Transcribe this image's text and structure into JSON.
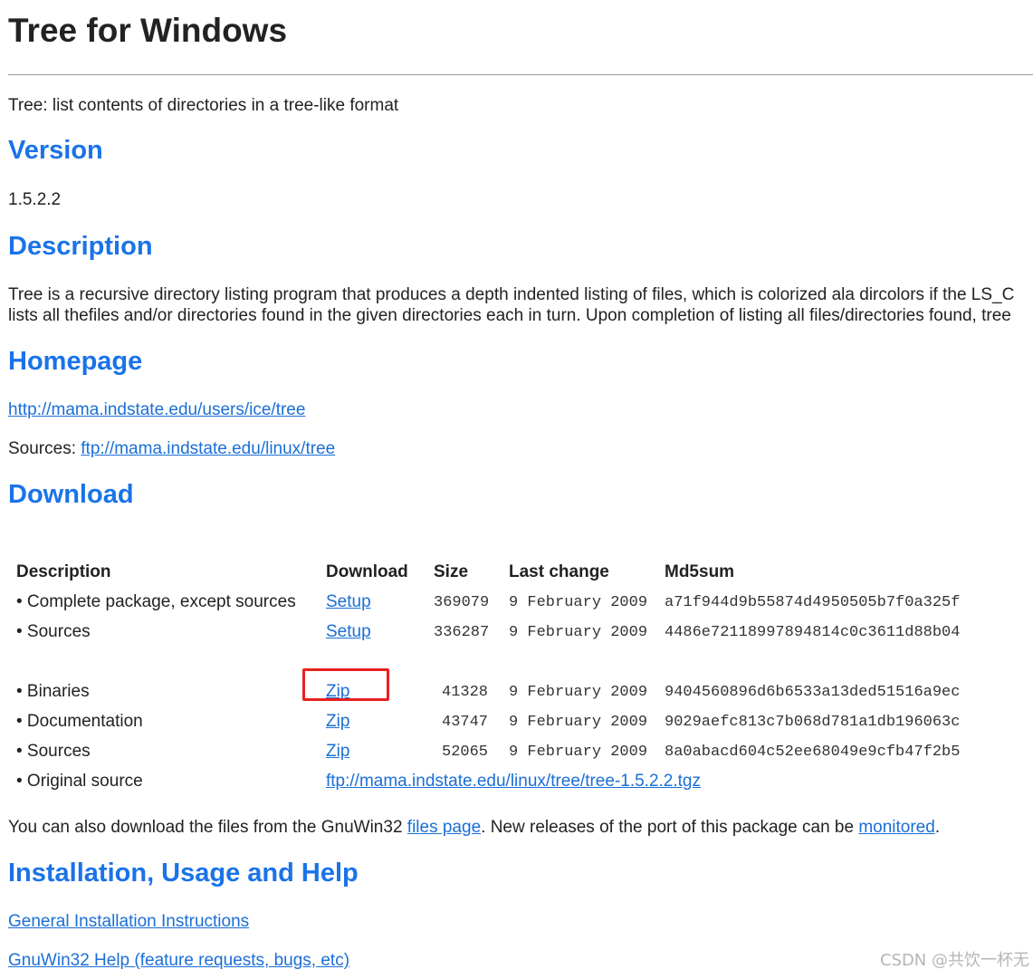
{
  "page": {
    "title": "Tree for Windows",
    "intro": "Tree: list contents of directories in a tree-like format"
  },
  "version": {
    "heading": "Version",
    "value": "1.5.2.2"
  },
  "description": {
    "heading": "Description",
    "line1": "Tree is a recursive directory listing program that produces a depth indented listing of files, which is colorized ala dircolors if the LS_C",
    "line2": "lists all thefiles and/or directories found in the given directories each in turn. Upon completion of listing all files/directories found, tree"
  },
  "homepage": {
    "heading": "Homepage",
    "url": "http://mama.indstate.edu/users/ice/tree",
    "sources_label": "Sources: ",
    "sources_url": "ftp://mama.indstate.edu/linux/tree"
  },
  "download": {
    "heading": "Download",
    "columns": [
      "Description",
      "Download",
      "Size",
      "Last change",
      "Md5sum"
    ],
    "rows": [
      {
        "description": "• Complete package, except sources",
        "link": "Setup",
        "size": "369079",
        "date": "9 February 2009",
        "md5": "a71f944d9b55874d4950505b7f0a325f"
      },
      {
        "description": "• Sources",
        "link": "Setup",
        "size": "336287",
        "date": "9 February 2009",
        "md5": "4486e72118997894814c0c3611d88b04"
      },
      {
        "description": "• Binaries",
        "link": "Zip",
        "size": "41328",
        "date": "9 February 2009",
        "md5": "9404560896d6b6533a13ded51516a9ec"
      },
      {
        "description": "• Documentation",
        "link": "Zip",
        "size": "43747",
        "date": "9 February 2009",
        "md5": "9029aefc813c7b068d781a1db196063c"
      },
      {
        "description": "• Sources",
        "link": "Zip",
        "size": "52065",
        "date": "9 February 2009",
        "md5": "8a0abacd604c52ee68049e9cfb47f2b5"
      },
      {
        "description": "• Original source",
        "link": "ftp://mama.indstate.edu/linux/tree/tree-1.5.2.2.tgz"
      }
    ],
    "note_prefix": "You can also download the files from the GnuWin32 ",
    "note_link1": "files page",
    "note_middle": ". New releases of the port of this package can be ",
    "note_link2": "monitored",
    "note_suffix": "."
  },
  "install": {
    "heading": "Installation, Usage and Help",
    "link1": "General Installation Instructions",
    "link2": "GnuWin32 Help (feature requests, bugs, etc)"
  },
  "watermark": "CSDN @共饮一杯无",
  "colors": {
    "heading": "#1a73e8",
    "link": "#1a6fd6",
    "highlight": "#e8201e"
  }
}
